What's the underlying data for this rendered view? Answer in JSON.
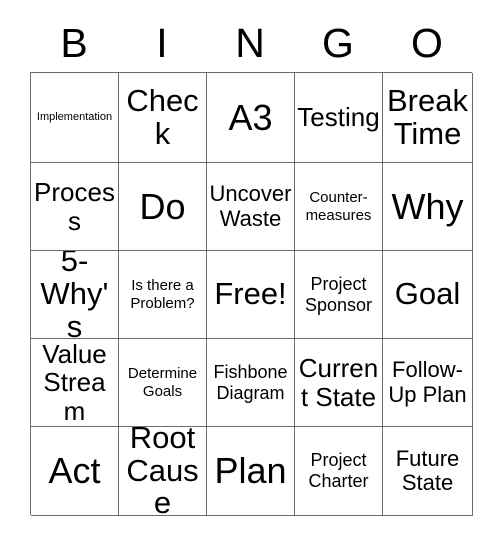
{
  "card": {
    "title": "BINGO",
    "headers": [
      "B",
      "I",
      "N",
      "G",
      "O"
    ],
    "colors": {
      "background": "#ffffff",
      "text": "#000000",
      "border": "#6b6b6b"
    },
    "rows": [
      [
        {
          "label": "Implementation",
          "size": "xs"
        },
        {
          "label": "Check",
          "size": "xxl"
        },
        {
          "label": "A3",
          "size": "huge"
        },
        {
          "label": "Testing",
          "size": "xl"
        },
        {
          "label": "Break Time",
          "size": "xxl"
        }
      ],
      [
        {
          "label": "Process",
          "size": "xl"
        },
        {
          "label": "Do",
          "size": "huge"
        },
        {
          "label": "Uncover Waste",
          "size": "lg"
        },
        {
          "label": "Counter-measures",
          "size": "sm"
        },
        {
          "label": "Why",
          "size": "huge"
        }
      ],
      [
        {
          "label": "5-Why's",
          "size": "xxl"
        },
        {
          "label": "Is there a Problem?",
          "size": "sm"
        },
        {
          "label": "Free!",
          "size": "xxl"
        },
        {
          "label": "Project Sponsor",
          "size": "md"
        },
        {
          "label": "Goal",
          "size": "xxl"
        }
      ],
      [
        {
          "label": "Value Stream",
          "size": "xl"
        },
        {
          "label": "Determine Goals",
          "size": "sm"
        },
        {
          "label": "Fishbone Diagram",
          "size": "md"
        },
        {
          "label": "Current State",
          "size": "xl"
        },
        {
          "label": "Follow-Up Plan",
          "size": "lg"
        }
      ],
      [
        {
          "label": "Act",
          "size": "huge"
        },
        {
          "label": "Root Cause",
          "size": "xxl"
        },
        {
          "label": "Plan",
          "size": "huge"
        },
        {
          "label": "Project Charter",
          "size": "md"
        },
        {
          "label": "Future State",
          "size": "lg"
        }
      ]
    ]
  }
}
